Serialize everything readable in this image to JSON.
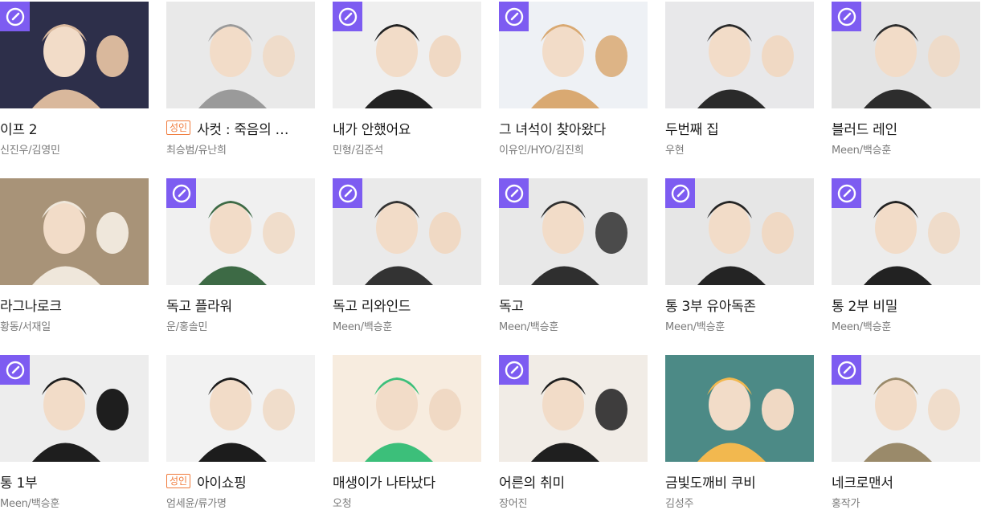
{
  "colors": {
    "badge": "#7d5cf1",
    "adult_tag": "#f07b3c"
  },
  "badge_icon": "clock-icon",
  "items": [
    {
      "title": "이프 2",
      "author": "신진우/김영민",
      "badge": true,
      "adult": "",
      "bg": "#2d2f4a",
      "fg": "#d9b89c"
    },
    {
      "title": "사컷 : 죽음의 …",
      "author": "최승범/유난희",
      "badge": false,
      "adult": "성인",
      "bg": "#e9e9e9",
      "fg": "#9a9a9a"
    },
    {
      "title": "내가 안했어요",
      "author": "민형/김준석",
      "badge": true,
      "adult": "",
      "bg": "#efefef",
      "fg": "#222222"
    },
    {
      "title": "그 녀석이 찾아왔다",
      "author": "이유인/HYO/김진희",
      "badge": true,
      "adult": "",
      "bg": "#eef1f5",
      "fg": "#d9a972"
    },
    {
      "title": "두번째 집",
      "author": "우현",
      "badge": false,
      "adult": "",
      "bg": "#e8e8ea",
      "fg": "#2a2a2a"
    },
    {
      "title": "블러드 레인",
      "author": "Meen/백승훈",
      "badge": true,
      "adult": "",
      "bg": "#e4e4e4",
      "fg": "#2d2d2d"
    },
    {
      "title": "라그나로크",
      "author": "황동/서재일",
      "badge": false,
      "adult": "",
      "bg": "#a89378",
      "fg": "#efe7db"
    },
    {
      "title": "독고 플라워",
      "author": "운/홍솔민",
      "badge": true,
      "adult": "",
      "bg": "#f0f0f0",
      "fg": "#3d6a45"
    },
    {
      "title": "독고 리와인드",
      "author": "Meen/백승훈",
      "badge": true,
      "adult": "",
      "bg": "#eaeaea",
      "fg": "#333333"
    },
    {
      "title": "독고",
      "author": "Meen/백승훈",
      "badge": true,
      "adult": "",
      "bg": "#e8e8e8",
      "fg": "#2f2f2f"
    },
    {
      "title": "통 3부 유아독존",
      "author": "Meen/백승훈",
      "badge": true,
      "adult": "",
      "bg": "#e6e6e6",
      "fg": "#242424"
    },
    {
      "title": "통 2부 비밀",
      "author": "Meen/백승훈",
      "badge": true,
      "adult": "",
      "bg": "#ececec",
      "fg": "#222222"
    },
    {
      "title": "통 1부",
      "author": "Meen/백승훈",
      "badge": true,
      "adult": "",
      "bg": "#ededed",
      "fg": "#1e1e1e"
    },
    {
      "title": "아이쇼핑",
      "author": "엄세윤/류가명",
      "badge": false,
      "adult": "성인",
      "bg": "#f2f2f2",
      "fg": "#1c1c1c"
    },
    {
      "title": "매생이가 나타났다",
      "author": "오청",
      "badge": false,
      "adult": "",
      "bg": "#f7ecdf",
      "fg": "#3cbf7a"
    },
    {
      "title": "어른의 취미",
      "author": "장어진",
      "badge": true,
      "adult": "",
      "bg": "#f1ece6",
      "fg": "#1f1f1f"
    },
    {
      "title": "금빛도깨비 쿠비",
      "author": "김성주",
      "badge": false,
      "adult": "",
      "bg": "#4c8a86",
      "fg": "#f2b84f"
    },
    {
      "title": "네크로맨서",
      "author": "홍작가",
      "badge": true,
      "adult": "",
      "bg": "#efefef",
      "fg": "#9a8a6a"
    }
  ]
}
